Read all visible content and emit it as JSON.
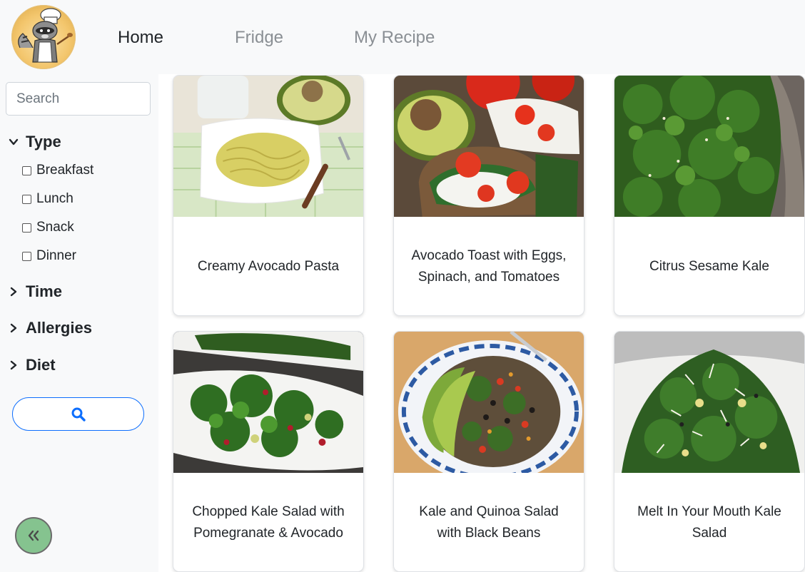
{
  "nav": {
    "home": "Home",
    "fridge": "Fridge",
    "my_recipe": "My Recipe"
  },
  "sidebar": {
    "search_placeholder": "Search",
    "filters": {
      "type": {
        "label": "Type",
        "options": [
          "Breakfast",
          "Lunch",
          "Snack",
          "Dinner"
        ]
      },
      "time": {
        "label": "Time"
      },
      "allergies": {
        "label": "Allergies"
      },
      "diet": {
        "label": "Diet"
      }
    }
  },
  "recipes": [
    {
      "title": "Creamy Avocado Pasta"
    },
    {
      "title": "Avocado Toast with Eggs, Spinach, and Tomatoes"
    },
    {
      "title": "Citrus Sesame Kale"
    },
    {
      "title": "Chopped Kale Salad with Pomegranate & Avocado"
    },
    {
      "title": "Kale and Quinoa Salad with Black Beans"
    },
    {
      "title": "Melt In Your Mouth Kale Salad"
    }
  ],
  "colors": {
    "accent": "#0d6efd",
    "collapse_button": "#85c38f",
    "background": "#f8f9fa"
  },
  "icons": {
    "search_button": "search-icon",
    "collapse_button": "double-chevron-left-icon",
    "filter_expanded": "chevron-down-icon",
    "filter_collapsed": "chevron-right-icon"
  }
}
